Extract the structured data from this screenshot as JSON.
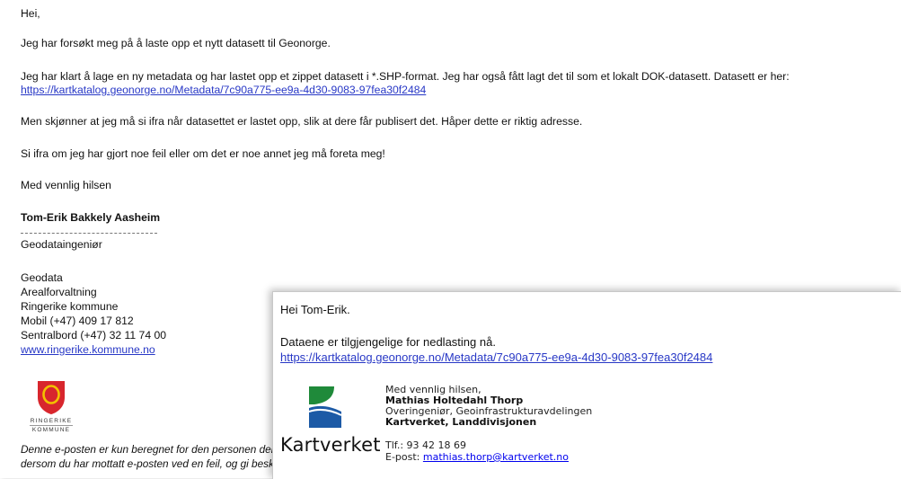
{
  "email1": {
    "greeting": "Hei,",
    "p1": "Jeg har forsøkt meg på å laste opp et nytt datasett til Geonorge.",
    "p2": "Jeg har klart å lage en ny metadata og har lastet opp et zippet datasett i *.SHP-format. Jeg har også fått lagt det til som et lokalt DOK-datasett. Datasett er her:",
    "link": "https://kartkatalog.geonorge.no/Metadata/7c90a775-ee9a-4d30-9083-97fea30f2484",
    "p3": "Men skjønner at jeg må si ifra når datasettet er lastet opp, slik at dere får publisert det. Håper dette er riktig adresse.",
    "p4": "Si ifra om jeg har gjort noe feil eller om det er noe annet jeg må foreta meg!",
    "closing": "Med vennlig hilsen",
    "sender_name": "Tom-Erik Bakkely Aasheim",
    "sender_title": "Geodataingeniør",
    "dept1": "Geodata",
    "dept2": "Arealforvaltning",
    "org": "Ringerike kommune",
    "mobile": "Mobil (+47) 409 17 812",
    "switchboard": "Sentralbord (+47) 32 11 74 00",
    "website": "www.ringerike.kommune.no",
    "logo_text_1": "RINGERIKE",
    "logo_text_2": "KOMMUNE",
    "disclaimer1": "Denne e-posten er kun beregnet for den personen der",
    "disclaimer2": "dersom du har mottatt e-posten ved en feil, og gi besk"
  },
  "email2": {
    "greeting": "Hei Tom-Erik.",
    "body": "Dataene er tilgjengelige for nedlasting nå.",
    "link": "https://kartkatalog.geonorge.no/Metadata/7c90a775-ee9a-4d30-9083-97fea30f2484",
    "sig_closing": "Med vennlig hilsen,",
    "sig_name": "Mathias Holtedahl Thorp",
    "sig_title": "Overingeniør, Geoinfrastrukturavdelingen",
    "sig_division": "Kartverket, Landdivisjonen",
    "phone": "Tlf.: 93 42 18 69",
    "email_label": "E-post: ",
    "email": "mathias.thorp@kartverket.no",
    "logo_text": "Kartverket"
  },
  "colors": {
    "link": "#2838c6",
    "kartverket_green": "#1f8a3a",
    "kartverket_blue": "#1c5aa6",
    "ringerike_red": "#d8262d",
    "ringerike_gold": "#f2c200"
  }
}
